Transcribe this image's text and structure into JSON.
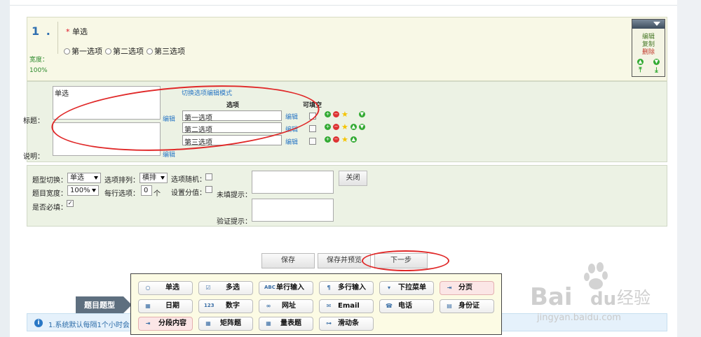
{
  "question": {
    "number": "1 .",
    "required_mark": "*",
    "title": "单选",
    "options": [
      "第一选项",
      "第二选项",
      "第三选项"
    ],
    "width_label": "宽度：",
    "width_value": "100%"
  },
  "toolbox": {
    "items": [
      "编辑",
      "复制",
      "删除"
    ],
    "colors": {
      "edit": "#4a7a2a",
      "copy": "#4a7a2a",
      "delete": "#c0392b"
    }
  },
  "editor": {
    "title_label": "标题：",
    "title_value": "单选",
    "desc_label": "说明：",
    "edit_link": "编辑",
    "switch_mode_link": "切换选项编辑模式",
    "options_header": "选项",
    "fillable_header": "可填空",
    "option_rows": [
      {
        "value": "第一选项",
        "edit": "编辑"
      },
      {
        "value": "第二选项",
        "edit": "编辑"
      },
      {
        "value": "第三选项",
        "edit": "编辑"
      }
    ]
  },
  "settings": {
    "type_switch_label": "题型切换：",
    "type_switch_value": "单选",
    "arrange_label": "选项排列：",
    "arrange_value": "横排",
    "random_label": "选项随机：",
    "width_label": "题目宽度：",
    "width_value": "100%",
    "per_row_label": "每行选项：",
    "per_row_value": "0",
    "per_row_unit": "个",
    "score_label": "设置分值：",
    "required_label": "是否必填：",
    "unfilled_hint_label": "未填提示：",
    "verify_hint_label": "验证提示：",
    "close_button": "关闭"
  },
  "actions": {
    "save": "保存",
    "save_preview": "保存并预览",
    "next": "下一步"
  },
  "palette": {
    "tag": "题目题型",
    "row1": [
      {
        "icon": "radio-icon",
        "label": "单选"
      },
      {
        "icon": "checkbox-icon",
        "label": "多选"
      },
      {
        "icon": "abc-icon",
        "label": "单行输入"
      },
      {
        "icon": "paragraph-icon",
        "label": "多行输入"
      },
      {
        "icon": "dropdown-icon",
        "label": "下拉菜单"
      },
      {
        "icon": "page-break-icon",
        "label": "分页"
      }
    ],
    "row2": [
      {
        "icon": "calendar-icon",
        "label": "日期"
      },
      {
        "icon": "number-icon",
        "label": "数字"
      },
      {
        "icon": "link-icon",
        "label": "网址"
      },
      {
        "icon": "email-icon",
        "label": "Email"
      },
      {
        "icon": "phone-icon",
        "label": "电话"
      },
      {
        "icon": "id-card-icon",
        "label": "身份证"
      }
    ],
    "row3": [
      {
        "icon": "section-icon",
        "label": "分段内容"
      },
      {
        "icon": "matrix-icon",
        "label": "矩阵题"
      },
      {
        "icon": "scale-icon",
        "label": "量表题"
      },
      {
        "icon": "slider-icon",
        "label": "滑动条"
      }
    ]
  },
  "notice": {
    "icon": "info-icon",
    "text": "1.系统默认每隔1个小时会"
  },
  "watermark": {
    "brand": "Bai",
    "brand2": "du",
    "cn": "经验",
    "url": "jingyan.baidu.com"
  },
  "annotation_color": "#e02828"
}
